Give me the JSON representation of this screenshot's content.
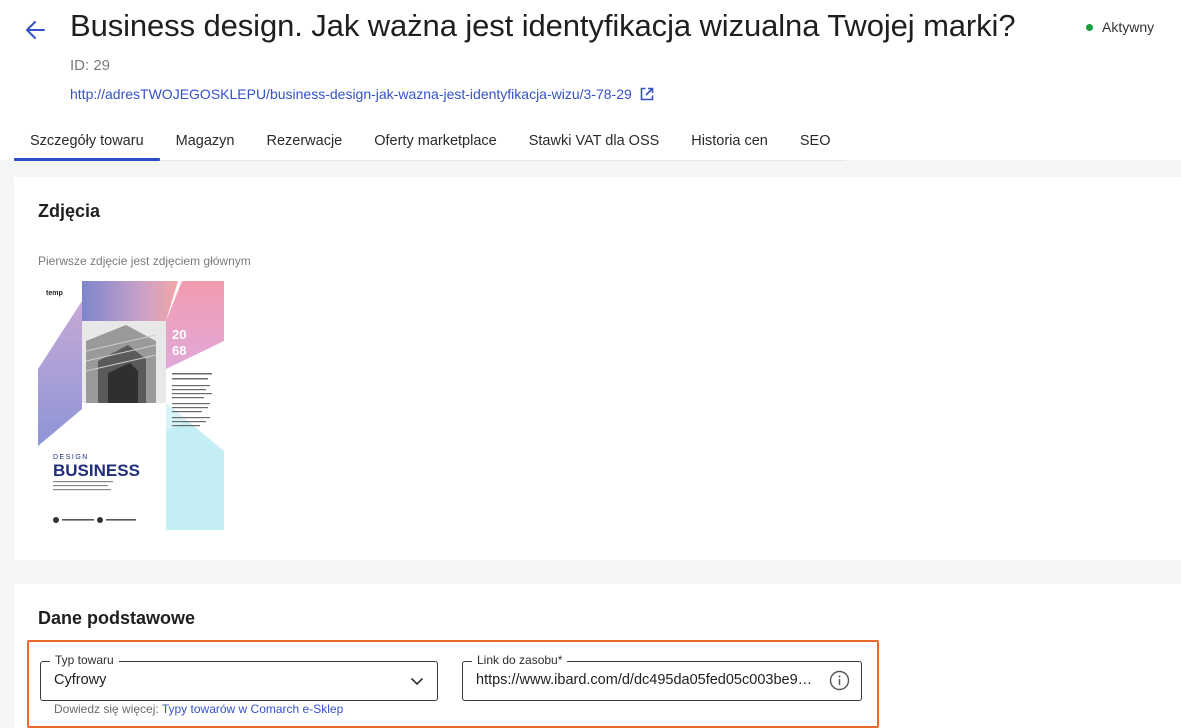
{
  "header": {
    "title": "Business design. Jak ważna jest identyfikacja wizualna Twojej marki?",
    "id_label": "ID: 29",
    "url": "http://adresTWOJEGOSKLEPU/business-design-jak-wazna-jest-identyfikacja-wizu/3-78-29",
    "status": "Aktywny",
    "status_color": "#1a9e45"
  },
  "tabs": [
    {
      "label": "Szczegóły towaru",
      "active": true
    },
    {
      "label": "Magazyn"
    },
    {
      "label": "Rezerwacje"
    },
    {
      "label": "Oferty marketplace"
    },
    {
      "label": "Stawki VAT dla OSS"
    },
    {
      "label": "Historia cen"
    },
    {
      "label": "SEO"
    }
  ],
  "photos": {
    "heading": "Zdjęcia",
    "hint": "Pierwsze zdjęcie jest zdjęciem głównym",
    "thumbnail": {
      "brand": "temp",
      "year_top": "20",
      "year_bottom": "68",
      "subtitle": "DESIGN",
      "title": "BUSINESS"
    }
  },
  "basic": {
    "heading": "Dane podstawowe",
    "type_label": "Typ towaru",
    "type_value": "Cyfrowy",
    "link_label": "Link do zasobu*",
    "link_value": "https://www.ibard.com/d/dc495da05fed05c003be9d...",
    "help_prefix": "Dowiedz się więcej:",
    "help_link": "Typy towarów w Comarch e-Sklep"
  },
  "colors": {
    "accent": "#2d4bc8",
    "link": "#3552c9",
    "highlight": "#ea6a2c"
  }
}
